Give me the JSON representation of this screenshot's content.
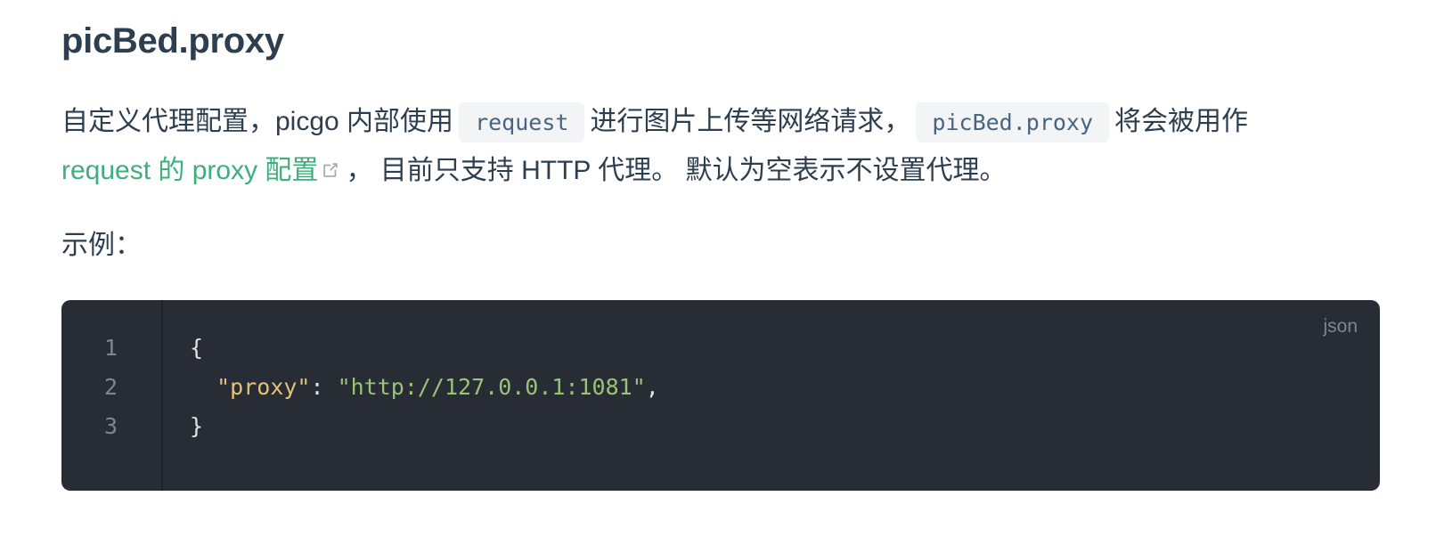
{
  "heading": "picBed.proxy",
  "description": {
    "part1": "自定义代理配置，picgo 内部使用",
    "code1": "request",
    "part2": "进行图片上传等网络请求，",
    "code2": "picBed.proxy",
    "part3": "将会被用作",
    "link_text": "request 的 proxy 配置",
    "part4": "， 目前只支持 HTTP 代理。 默认为空表示不设置代理。"
  },
  "example_label": "示例：",
  "code_block": {
    "language": "json",
    "line_numbers": [
      "1",
      "2",
      "3"
    ],
    "line1": "{",
    "line2_indent": "  ",
    "line2_key": "\"proxy\"",
    "line2_colon": ": ",
    "line2_value": "\"http://127.0.0.1:1081\"",
    "line2_comma": ",",
    "line3": "}"
  },
  "colors": {
    "text": "#2c3e50",
    "link": "#3eaf7c",
    "code_bg": "#282c34",
    "json_key": "#e5c07b",
    "json_string": "#98c379"
  },
  "icons": [
    "external-link-icon"
  ]
}
